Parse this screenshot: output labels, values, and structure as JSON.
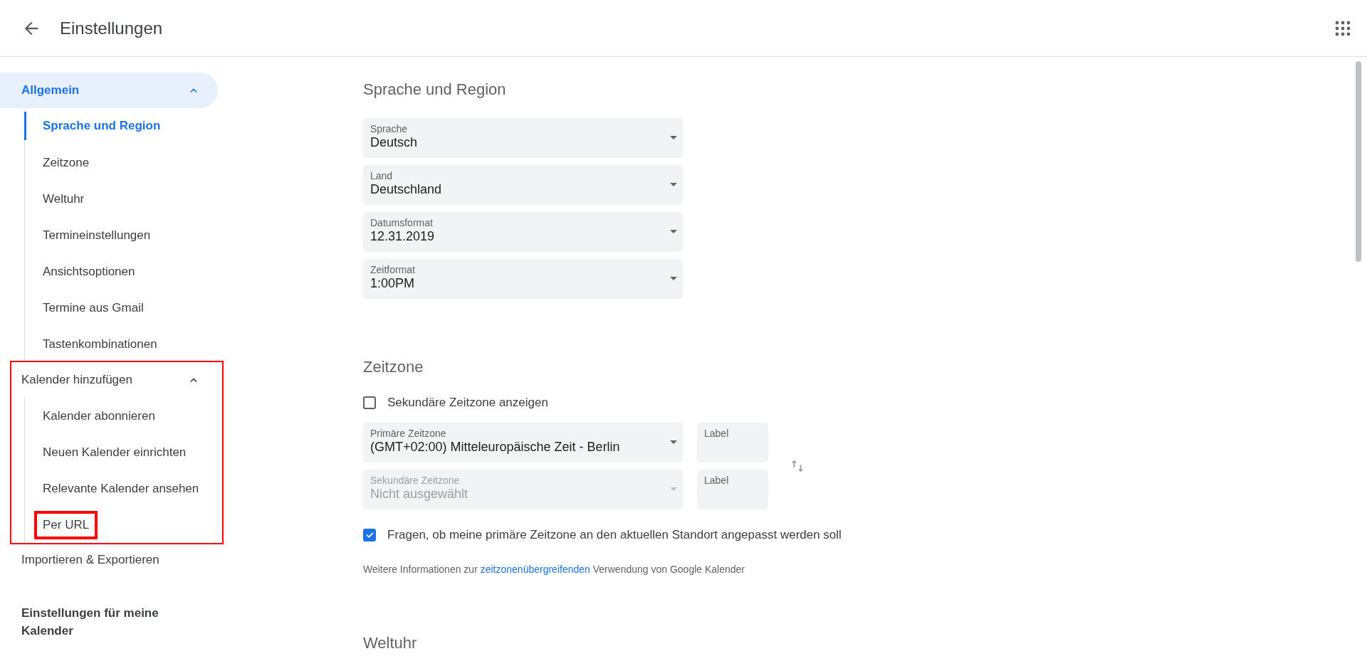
{
  "header": {
    "title": "Einstellungen"
  },
  "sidebar": {
    "sections": [
      {
        "kind": "group",
        "label": "Allgemein",
        "selected": true,
        "expanded": true,
        "children": [
          {
            "label": "Sprache und Region",
            "selected": true,
            "highlighted": false
          },
          {
            "label": "Zeitzone",
            "selected": false,
            "highlighted": false
          },
          {
            "label": "Weltuhr",
            "selected": false,
            "highlighted": false
          },
          {
            "label": "Termineinstellungen",
            "selected": false,
            "highlighted": false
          },
          {
            "label": "Ansichtsoptionen",
            "selected": false,
            "highlighted": false
          },
          {
            "label": "Termine aus Gmail",
            "selected": false,
            "highlighted": false
          },
          {
            "label": "Tastenkombinationen",
            "selected": false,
            "highlighted": false
          }
        ]
      },
      {
        "kind": "group",
        "label": "Kalender hinzufügen",
        "selected": false,
        "expanded": true,
        "highlighted": true,
        "children": [
          {
            "label": "Kalender abonnieren",
            "selected": false,
            "highlighted": false
          },
          {
            "label": "Neuen Kalender einrichten",
            "selected": false,
            "highlighted": false
          },
          {
            "label": "Relevante Kalender ansehen",
            "selected": false,
            "highlighted": false
          },
          {
            "label": "Per URL",
            "selected": false,
            "highlighted": true
          }
        ]
      },
      {
        "kind": "link",
        "label": "Importieren & Exportieren",
        "selected": false
      },
      {
        "kind": "heading",
        "label": "Einstellungen für meine Kalender"
      }
    ]
  },
  "content": {
    "sections": [
      {
        "title": "Sprache und Region",
        "items": [
          {
            "kind": "select",
            "label": "Sprache",
            "value": "Deutsch",
            "disabled": false
          },
          {
            "kind": "select",
            "label": "Land",
            "value": "Deutschland",
            "disabled": false
          },
          {
            "kind": "select",
            "label": "Datumsformat",
            "value": "12.31.2019",
            "disabled": false
          },
          {
            "kind": "select",
            "label": "Zeitformat",
            "value": "1:00PM",
            "disabled": false
          }
        ]
      },
      {
        "title": "Zeitzone",
        "items": [
          {
            "kind": "checkbox",
            "label": "Sekundäre Zeitzone anzeigen",
            "checked": false
          },
          {
            "kind": "zones",
            "rows": [
              {
                "label": "Primäre Zeitzone",
                "value": "(GMT+02:00) Mitteleuropäische Zeit - Berlin",
                "disabled": false,
                "label_field": {
                  "placeholder": "Label"
                }
              },
              {
                "label": "Sekundäre Zeitzone",
                "value": "Nicht ausgewählt",
                "disabled": true,
                "label_field": {
                  "placeholder": "Label"
                }
              }
            ]
          },
          {
            "kind": "checkbox",
            "label": "Fragen, ob meine primäre Zeitzone an den aktuellen Standort angepasst werden soll",
            "checked": true
          },
          {
            "kind": "info",
            "before": "Weitere Informationen zur ",
            "link": "zeitzonenübergreifenden",
            "after": " Verwendung von Google Kalender"
          }
        ]
      },
      {
        "title": "Weltuhr"
      }
    ]
  }
}
